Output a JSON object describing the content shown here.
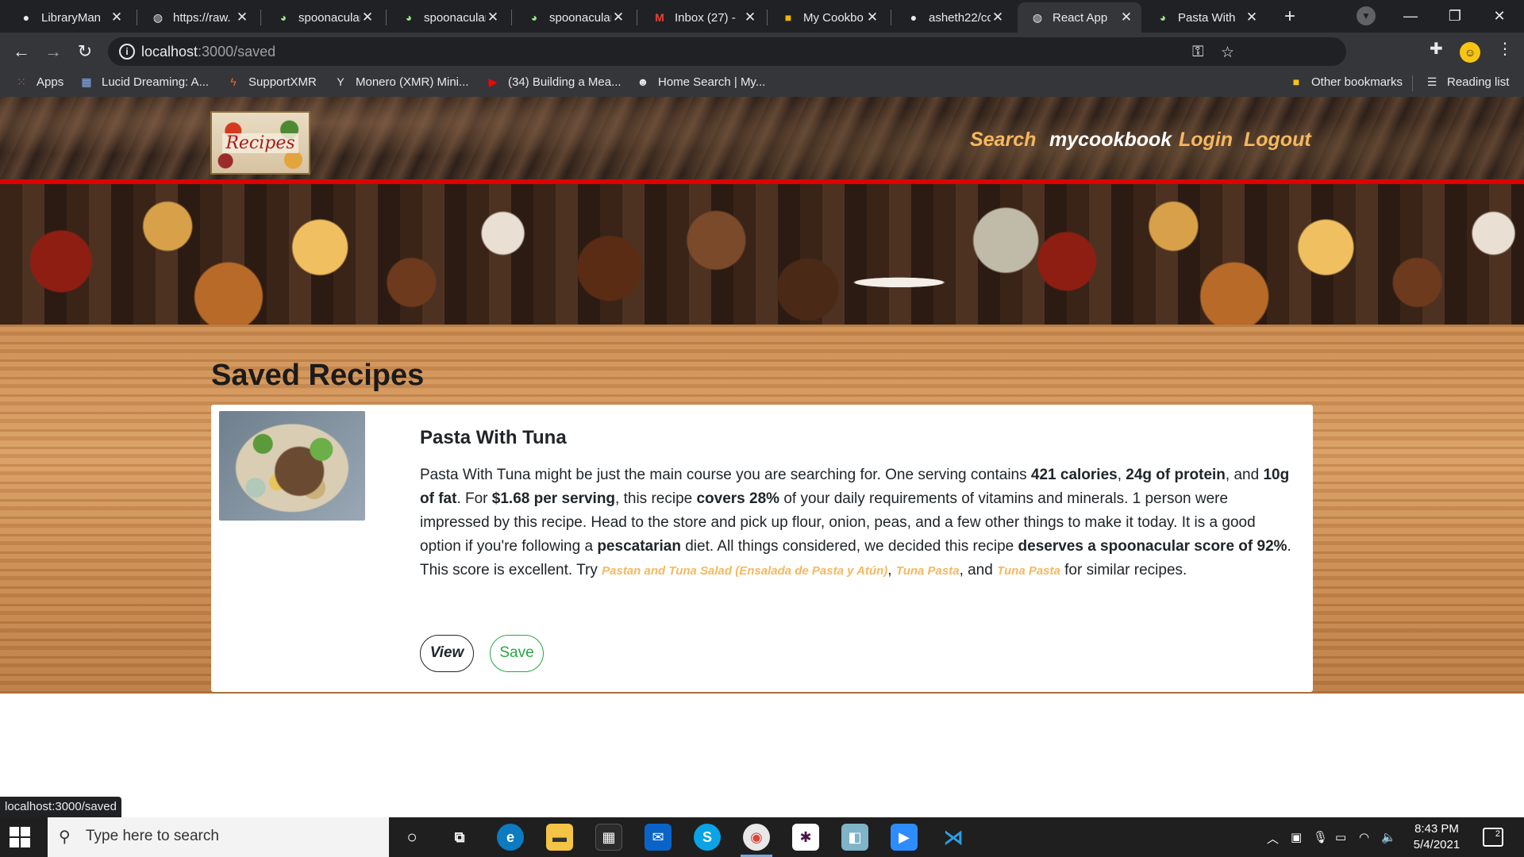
{
  "browser": {
    "tabs": [
      {
        "title": "LibraryMan",
        "icon": "github-icon"
      },
      {
        "title": "https://raw.",
        "icon": "globe-icon"
      },
      {
        "title": "spoonacular",
        "icon": "spoonacular-icon"
      },
      {
        "title": "spoonacular",
        "icon": "spoonacular-icon"
      },
      {
        "title": "spoonacular",
        "icon": "spoonacular-icon"
      },
      {
        "title": "Inbox (27) -",
        "icon": "gmail-icon"
      },
      {
        "title": "My Cookbo",
        "icon": "slides-icon"
      },
      {
        "title": "asheth22/cc",
        "icon": "github-icon"
      },
      {
        "title": "React App",
        "icon": "globe-icon"
      },
      {
        "title": "Pasta With",
        "icon": "spoonacular-icon"
      }
    ],
    "url_host": "localhost",
    "url_path": ":3000/saved",
    "bookmarks": [
      {
        "label": "Apps",
        "icon": "apps-grid-icon"
      },
      {
        "label": "Lucid Dreaming: A...",
        "icon": "grid-icon"
      },
      {
        "label": "SupportXMR",
        "icon": "supportxmr-icon"
      },
      {
        "label": "Monero (XMR) Mini...",
        "icon": "cocktail-icon"
      },
      {
        "label": "(34) Building a Mea...",
        "icon": "youtube-icon"
      },
      {
        "label": "Home Search | My...",
        "icon": "smiley-icon"
      }
    ],
    "other_bookmarks": "Other bookmarks",
    "reading_list": "Reading list",
    "status_url": "localhost:3000/saved",
    "accent_active_tab": "#35363a"
  },
  "site": {
    "logo_text": "Recipes",
    "nav": {
      "search": "Search",
      "mycookbook": "mycookbook",
      "login": "Login",
      "logout": "Logout"
    },
    "page_title": "Saved Recipes",
    "recipe": {
      "title": "Pasta With Tuna",
      "summary": {
        "t1": "Pasta With Tuna might be just the main course you are searching for. One serving contains ",
        "b1": "421 calories",
        "t2": ", ",
        "b2": "24g of protein",
        "t3": ", and ",
        "b3": "10g of fat",
        "t4": ". For ",
        "b4": "$1.68 per serving",
        "t5": ", this recipe ",
        "b5": "covers 28%",
        "t6": " of your daily requirements of vitamins and minerals. 1 person were impressed by this recipe. Head to the store and pick up flour, onion, peas, and a few other things to make it today. It is a good option if you're following a ",
        "b6": "pescatarian",
        "t7": " diet. All things considered, we decided this recipe ",
        "b7": "deserves a spoonacular score of 92%",
        "t8": ". This score is excellent. Try ",
        "l1": "Pastan and Tuna Salad (Ensalada de Pasta y Atún)",
        "t9": ", ",
        "l2": "Tuna Pasta",
        "t10": ", and ",
        "l3": "Tuna Pasta",
        "t11": " for similar recipes."
      },
      "view_label": "View",
      "save_label": "Save"
    },
    "colors": {
      "nav_link": "#f5b85f",
      "header_border": "#e00000",
      "save_green": "#28a745"
    }
  },
  "taskbar": {
    "search_placeholder": "Type here to search",
    "time": "8:43 PM",
    "date": "5/4/2021",
    "notifications": "2"
  }
}
